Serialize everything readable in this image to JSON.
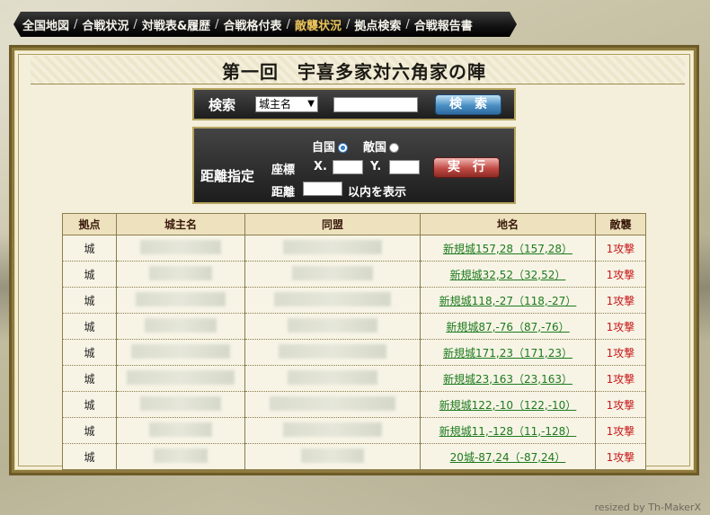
{
  "nav": {
    "items": [
      {
        "label": "全国地図",
        "active": false
      },
      {
        "label": "合戦状況",
        "active": false
      },
      {
        "label": "対戦表&履歴",
        "active": false
      },
      {
        "label": "合戦格付表",
        "active": false
      },
      {
        "label": "敵襲状況",
        "active": true
      },
      {
        "label": "拠点検索",
        "active": false
      },
      {
        "label": "合戦報告書",
        "active": false
      }
    ],
    "separator": "/"
  },
  "page": {
    "title": "第一回　宇喜多家対六角家の陣"
  },
  "search": {
    "label": "検索",
    "select_value": "城主名",
    "input_value": "",
    "button_label": "検　索"
  },
  "distance": {
    "label": "距離指定",
    "own_country": "自国",
    "enemy_country": "敵国",
    "own_selected": true,
    "coord_label": "座標",
    "x_label": "X.",
    "y_label": "Y.",
    "dist_label": "距離",
    "suffix": "以内を表示",
    "x_value": "",
    "y_value": "",
    "dist_value": "",
    "button_label": "実　行"
  },
  "table": {
    "headers": [
      "拠点",
      "城主名",
      "同盟",
      "地名",
      "敵襲"
    ],
    "rows": [
      {
        "type": "城",
        "place": "新規城157,28（157,28）",
        "attack": "1攻撃"
      },
      {
        "type": "城",
        "place": "新規城32,52（32,52）",
        "attack": "1攻撃"
      },
      {
        "type": "城",
        "place": "新規城118,-27（118,-27）",
        "attack": "1攻撃"
      },
      {
        "type": "城",
        "place": "新規城87,-76（87,-76）",
        "attack": "1攻撃"
      },
      {
        "type": "城",
        "place": "新規城171,23（171,23）",
        "attack": "1攻撃"
      },
      {
        "type": "城",
        "place": "新規城23,163（23,163）",
        "attack": "1攻撃"
      },
      {
        "type": "城",
        "place": "新規城122,-10（122,-10）",
        "attack": "1攻撃"
      },
      {
        "type": "城",
        "place": "新規城11,-128（11,-128）",
        "attack": "1攻撃"
      },
      {
        "type": "城",
        "place": "20城-87,24（-87,24）",
        "attack": "1攻撃"
      }
    ]
  },
  "footer": {
    "watermark": "resized by Th-MakerX"
  }
}
